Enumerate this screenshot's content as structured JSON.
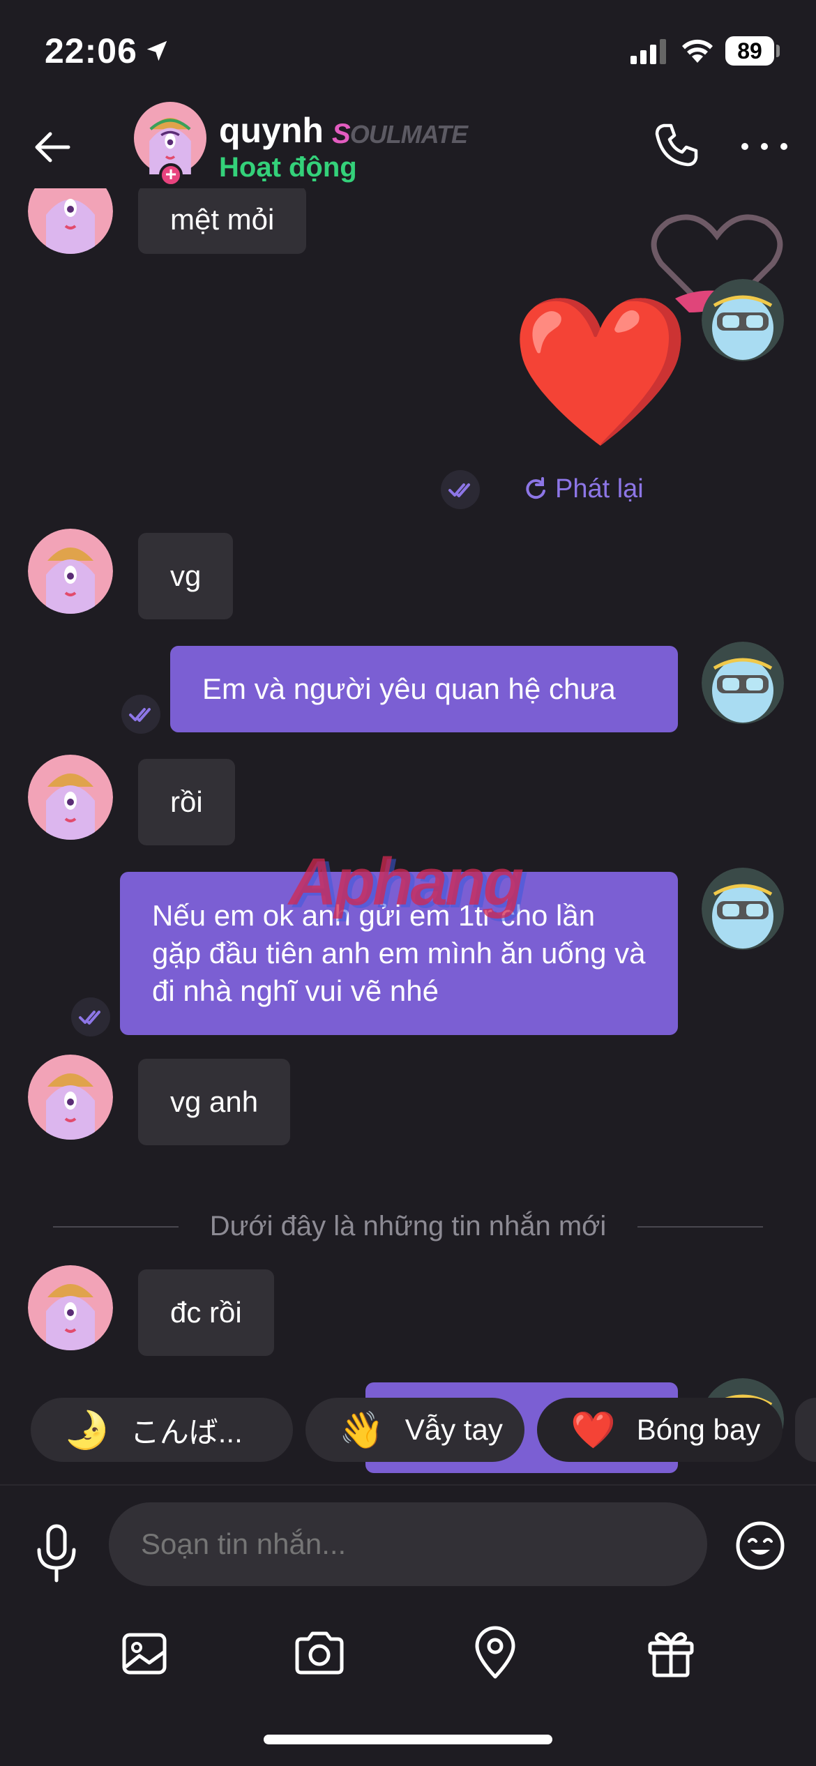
{
  "status_bar": {
    "time": "22:06",
    "battery": "89"
  },
  "header": {
    "contact_name": "quynh",
    "badge": "SOULMATE",
    "badge_first": "S",
    "badge_rest": "OULMATE",
    "status": "Hoạt động",
    "status_color": "#34d17a"
  },
  "messages": [
    {
      "side": "left",
      "text": "mệt mỏi"
    },
    {
      "side": "right",
      "type": "sticker",
      "text": "❤️"
    },
    {
      "side": "left",
      "text": "vg"
    },
    {
      "side": "right",
      "text": "Em và người yêu quan hệ chưa"
    },
    {
      "side": "left",
      "text": "rồi"
    },
    {
      "side": "right",
      "text": "Nếu em ok anh gửi em 1tr cho lần gặp đầu tiên anh em mình ăn uống và đi nhà nghĩ vui vẽ nhé"
    },
    {
      "side": "left",
      "text": "vg anh"
    },
    {
      "side": "left",
      "text": "đc rồi"
    }
  ],
  "replay_label": "Phát lại",
  "new_messages_divider": "Dưới đây là những tin nhắn mới",
  "watermark": "Aphang",
  "quick_replies": [
    {
      "emoji": "🌛",
      "label": "こんば..."
    },
    {
      "emoji": "👋",
      "label": "Vẫy tay"
    },
    {
      "emoji": "❤️",
      "label": "Bóng bay"
    }
  ],
  "composer": {
    "placeholder": "Soạn tin nhắn..."
  },
  "colors": {
    "background": "#1e1c22",
    "incoming_bubble": "#323036",
    "outgoing_bubble": "#7b5fd3",
    "accent": "#8d76e6"
  },
  "icons": [
    "back-arrow-icon",
    "phone-icon",
    "more-icon",
    "read-receipt-icon",
    "replay-icon",
    "microphone-icon",
    "emoji-icon",
    "gallery-icon",
    "camera-icon",
    "location-icon",
    "gift-icon"
  ]
}
